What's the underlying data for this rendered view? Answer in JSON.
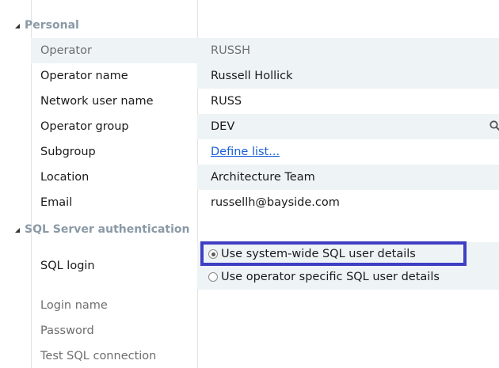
{
  "personal": {
    "header": "Personal",
    "rows": [
      {
        "label": "Operator",
        "value": "RUSSH"
      },
      {
        "label": "Operator name",
        "value": "Russell Hollick"
      },
      {
        "label": "Network user name",
        "value": "RUSS"
      },
      {
        "label": "Operator group",
        "value": "DEV"
      },
      {
        "label": "Subgroup",
        "value": "Define list..."
      },
      {
        "label": "Location",
        "value": "Architecture Team"
      },
      {
        "label": "Email",
        "value": "russellh@bayside.com"
      }
    ]
  },
  "sql": {
    "header": "SQL Server authentication",
    "login_label": "SQL login",
    "options": [
      {
        "label": "Use system-wide SQL user details",
        "selected": true
      },
      {
        "label": "Use operator specific SQL user details",
        "selected": false
      }
    ],
    "login_name_label": "Login name",
    "password_label": "Password",
    "test_label": "Test SQL connection"
  },
  "colors": {
    "highlight": "#3f3fc4",
    "header_text": "#8a9aa6",
    "link": "#1a5fd6",
    "shade": "#eef3f6"
  }
}
